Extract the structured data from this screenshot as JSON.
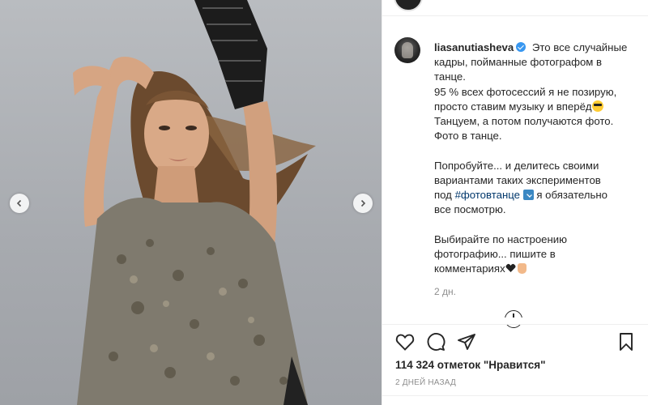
{
  "post": {
    "username": "liasanutiasheva",
    "caption_lines": [
      "Это все случайные",
      "кадры, пойманные фотографом в",
      "танце.",
      "95 % всех фотосессий я не позирую,",
      "просто ставим музыку и вперёд",
      "Танцуем, а потом получаются фото.",
      "Фото в танце.",
      "",
      "Попробуйте... и делитесь своими",
      "вариантами таких экспериментов",
      "под",
      "#фотовтанце",
      "я обязательно",
      "все посмотрю.",
      "",
      "Выбирайте по настроению",
      "фотографию... пишите в",
      "комментариях"
    ],
    "caption_time": "2 дн.",
    "likes_text": "114 324 отметок \"Нравится\"",
    "date_text": "2 ДНЕЙ НАЗАД"
  },
  "icons": {
    "like": "heart-outline-icon",
    "comment": "comment-bubble-icon",
    "share": "paper-plane-icon",
    "save": "bookmark-icon",
    "prev": "chevron-left-icon",
    "next": "chevron-right-icon",
    "verified": "verified-badge-icon",
    "load_more": "plus-circle-icon"
  },
  "colors": {
    "verified": "#3897f0",
    "hashtag": "#00376b",
    "text": "#262626",
    "muted": "#8e8e8e"
  }
}
